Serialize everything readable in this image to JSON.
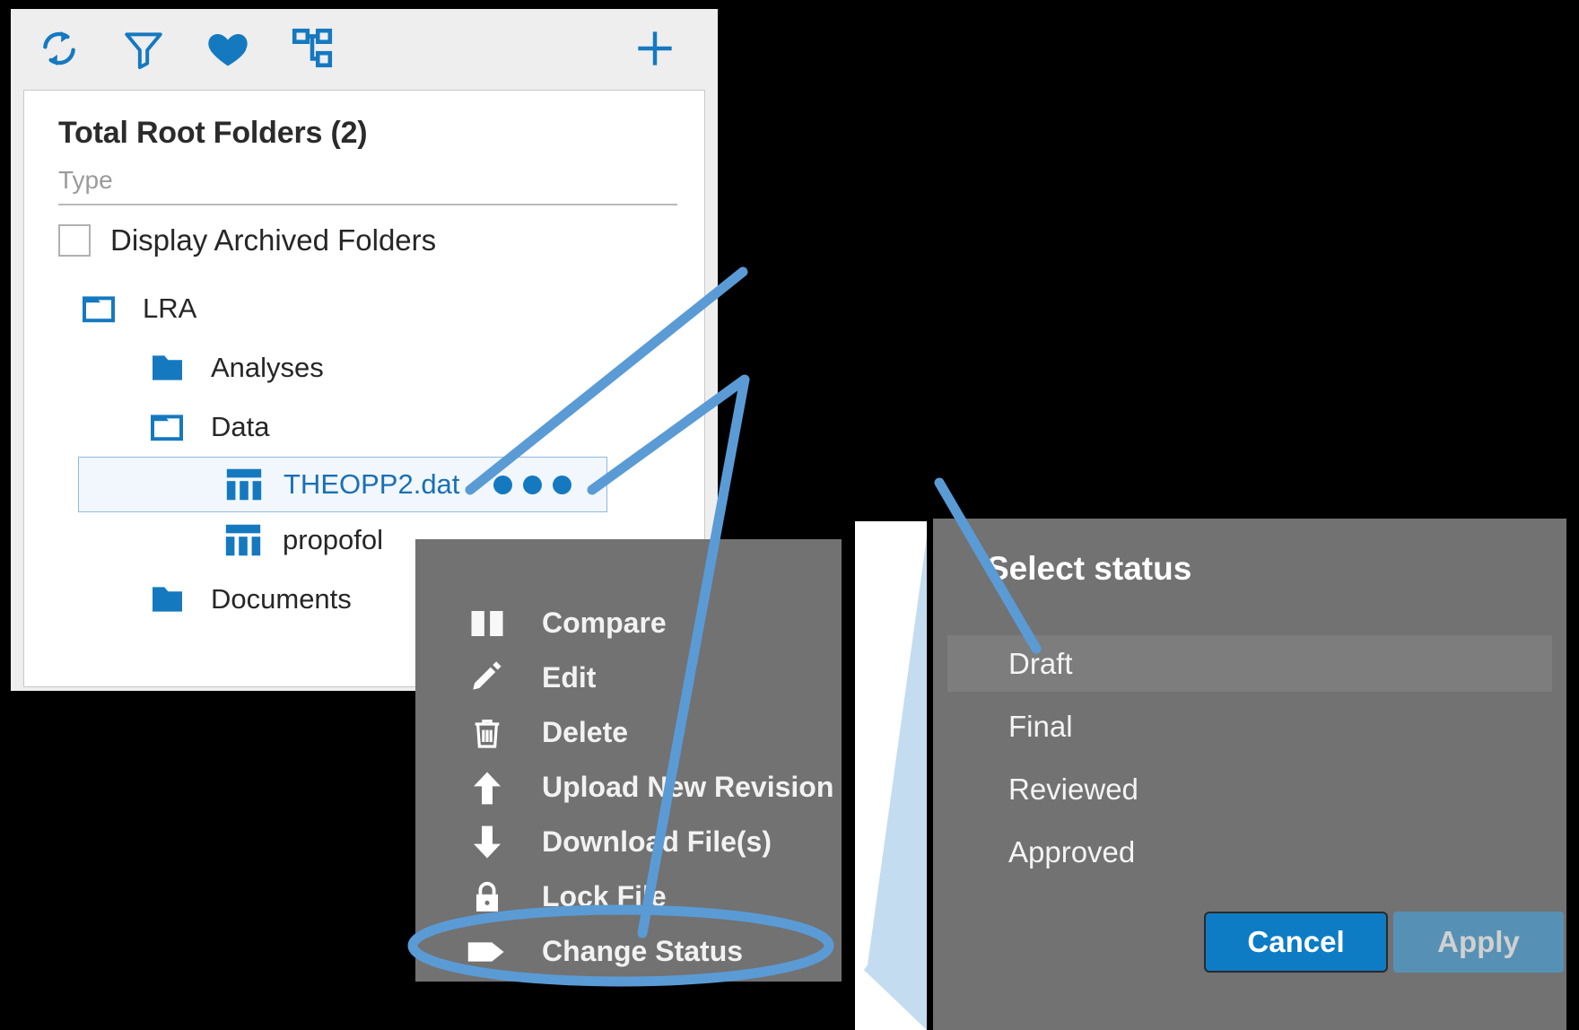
{
  "toolbar": {
    "icons": [
      {
        "name": "refresh-icon",
        "label": "Refresh"
      },
      {
        "name": "filter-icon",
        "label": "Filter"
      },
      {
        "name": "favorite-icon",
        "label": "Favorites"
      },
      {
        "name": "hierarchy-icon",
        "label": "Hierarchy"
      }
    ],
    "add_label": "+"
  },
  "tree": {
    "root_title": "Total Root Folders (2)",
    "type_label": "Type",
    "archived_label": "Display Archived Folders",
    "archived_checked": false,
    "rows": [
      {
        "label": "LRA",
        "icon": "folder-outline-icon"
      },
      {
        "label": "Analyses",
        "icon": "folder-filled-icon"
      },
      {
        "label": "Data",
        "icon": "folder-outline-icon"
      },
      {
        "label": "THEOPP2.dat",
        "icon": "dataset-icon",
        "selected": true
      },
      {
        "label": "propofol",
        "icon": "dataset-icon"
      },
      {
        "label": "Documents",
        "icon": "folder-filled-icon"
      }
    ]
  },
  "context_menu": {
    "items": [
      {
        "label": "Compare",
        "icon": "compare-icon"
      },
      {
        "label": "Edit",
        "icon": "pencil-icon"
      },
      {
        "label": "Delete",
        "icon": "trash-icon"
      },
      {
        "label": "Upload New Revision",
        "icon": "upload-arrow-icon"
      },
      {
        "label": "Download File(s)",
        "icon": "download-arrow-icon"
      },
      {
        "label": "Lock File",
        "icon": "lock-icon"
      },
      {
        "label": "Change Status",
        "icon": "tag-icon",
        "highlighted": true
      }
    ]
  },
  "status_dialog": {
    "title": "Select status",
    "options": [
      {
        "label": "Draft",
        "selected": true
      },
      {
        "label": "Final",
        "selected": false
      },
      {
        "label": "Reviewed",
        "selected": false
      },
      {
        "label": "Approved",
        "selected": false
      }
    ],
    "cancel_label": "Cancel",
    "apply_label": "Apply",
    "apply_disabled": true
  },
  "colors": {
    "accent_blue": "#1579c0",
    "annotation_blue": "#5b9bd5",
    "menu_gray": "#727272",
    "panel_gray": "#eeeeee",
    "selected_row": "#f1f7fc",
    "wedge_blue": "#c4dcf0",
    "button_blue": "#0d7cc4",
    "button_disabled": "#5691b5"
  }
}
